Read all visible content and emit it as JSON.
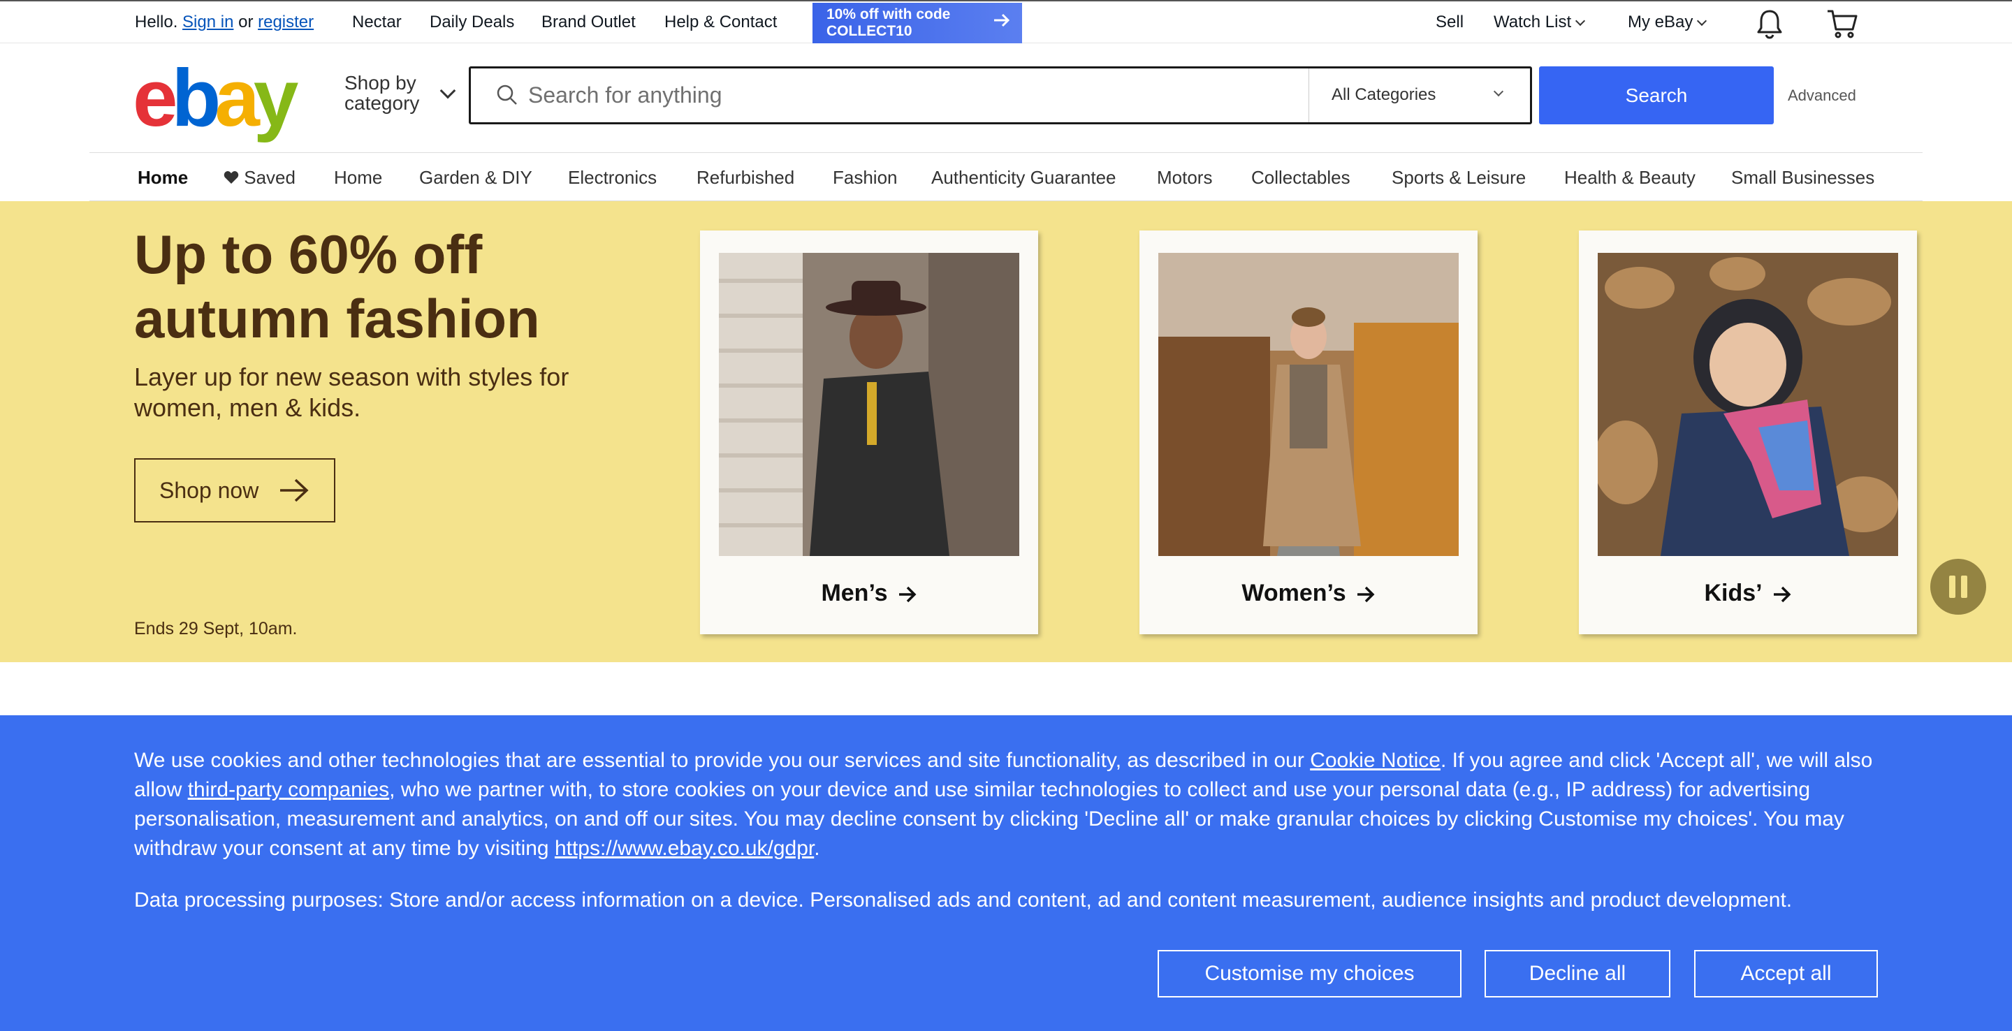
{
  "topbar": {
    "hello": "Hello.",
    "sign_in": "Sign in",
    "or": "or",
    "register": "register",
    "links": [
      "Nectar",
      "Daily Deals",
      "Brand Outlet",
      "Help & Contact"
    ],
    "promo_line1": "10% off with code",
    "promo_line2": "COLLECT10",
    "sell": "Sell",
    "watch_list": "Watch List",
    "my_ebay": "My eBay",
    "icons": [
      "notification-bell-icon",
      "cart-icon"
    ]
  },
  "header": {
    "logo": [
      "e",
      "b",
      "a",
      "y"
    ],
    "logo_colors": [
      "#e53238",
      "#0064d2",
      "#f5af02",
      "#86b817"
    ],
    "shop_by_line1": "Shop by",
    "shop_by_line2": "category",
    "search_placeholder": "Search for anything",
    "category_selected": "All Categories",
    "search_button": "Search",
    "advanced": "Advanced",
    "accent_color": "#3665f3"
  },
  "nav": {
    "tabs": [
      "Home",
      "Saved",
      "Home",
      "Garden & DIY",
      "Electronics",
      "Refurbished",
      "Fashion",
      "Authenticity Guarantee",
      "Motors",
      "Collectables",
      "Sports & Leisure",
      "Health & Beauty",
      "Small Businesses"
    ]
  },
  "hero": {
    "title": "Up to 60% off autumn fashion",
    "subtitle": "Layer up for new season with styles for women, men & kids.",
    "cta": "Shop now",
    "ends": "Ends 29 Sept, 10am.",
    "background": "#f4e38d",
    "cards": [
      {
        "label": "Men’s"
      },
      {
        "label": "Women’s"
      },
      {
        "label": "Kids’"
      }
    ]
  },
  "cookie": {
    "text_1": "We use cookies and other technologies that are essential to provide you our services and site functionality, as described in our ",
    "cookie_notice": "Cookie Notice",
    "text_2": ". If you agree and click 'Accept all', we will also allow ",
    "third_party": "third-party companies",
    "text_3": ", who we partner with, to store cookies on your device and use similar technologies to collect and use your personal data (e.g., IP address) for advertising personalisation, measurement and analytics, on and off our sites. You may decline consent by clicking 'Decline all' or make granular choices by clicking Customise my choices'. You may withdraw your consent at any time by visiting ",
    "gdpr_link": "https://www.ebay.co.uk/gdpr",
    "text_4": ".",
    "purposes": "Data processing purposes: Store and/or access information on a device. Personalised ads and content, ad and content measurement, audience insights and product development.",
    "customise": "Customise my choices",
    "decline": "Decline all",
    "accept": "Accept all",
    "background": "#3a6ff0"
  }
}
